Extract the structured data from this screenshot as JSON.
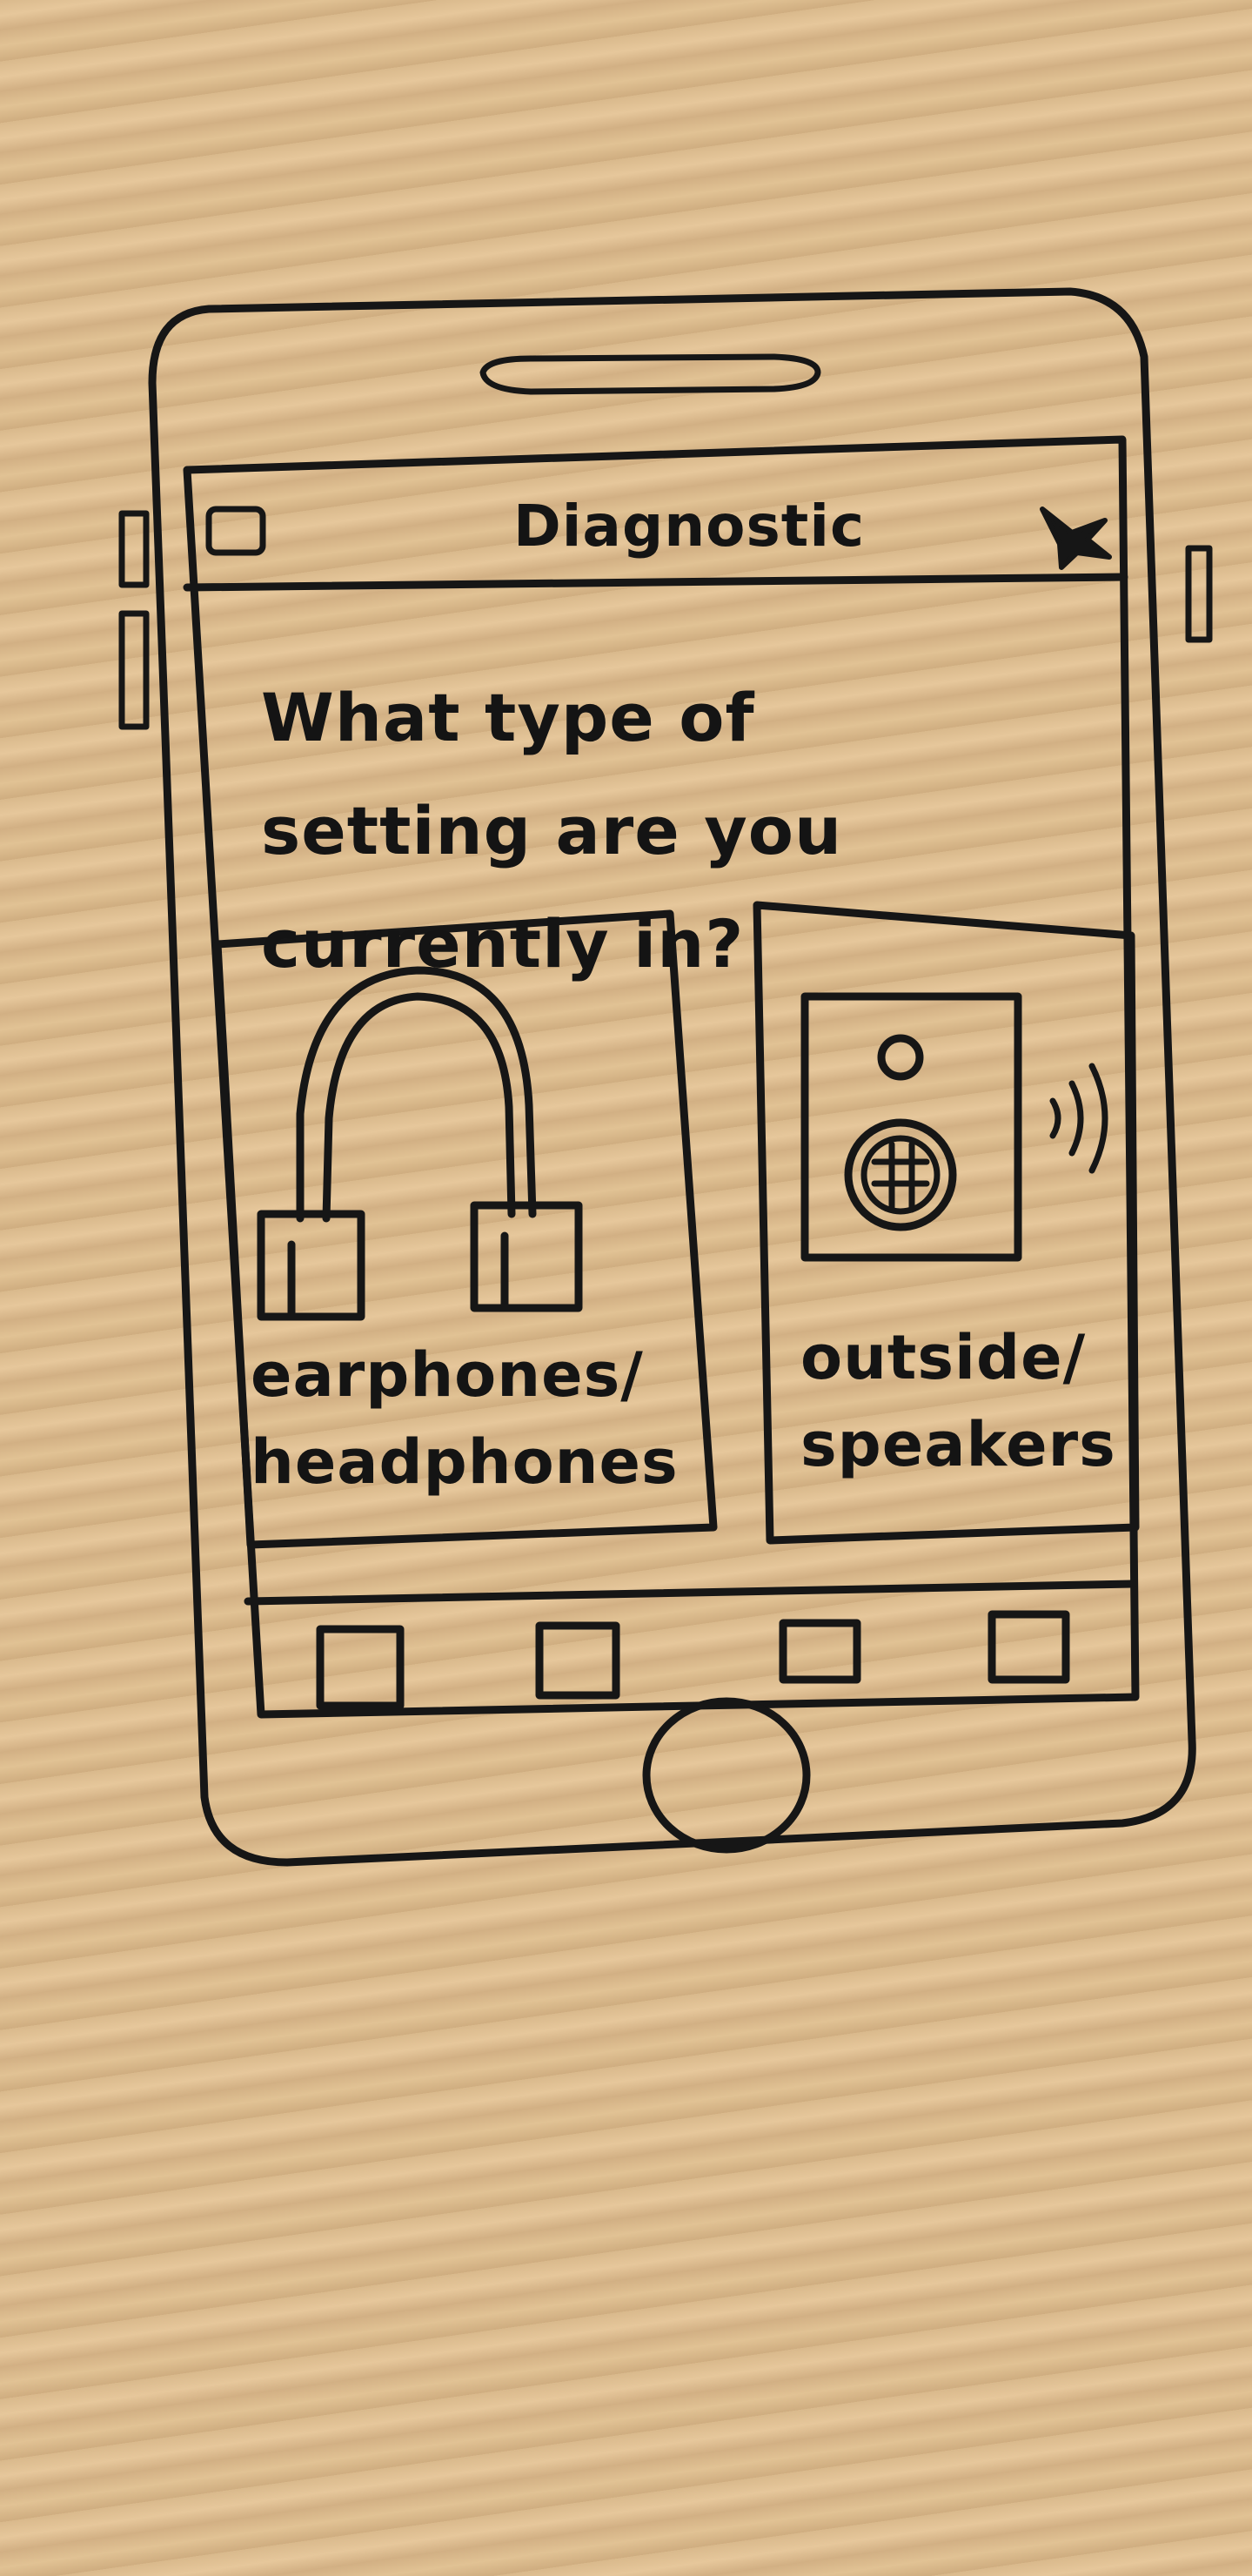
{
  "header": {
    "title": "Diagnostic",
    "left_icon": "square-icon",
    "right_icon": "bird-icon"
  },
  "question": "What type of setting are you currently in?",
  "options": [
    {
      "label": "earphones/ headphones",
      "icon": "headphones-icon"
    },
    {
      "label": "outside/ speakers",
      "icon": "speaker-icon"
    }
  ],
  "tabbar": {
    "icons": [
      "tab-square-icon",
      "tab-square-icon",
      "tab-square-icon",
      "tab-square-icon"
    ]
  },
  "home_button_icon": "circle-icon",
  "colors": {
    "ink": "#161616",
    "paper": "#f7f6f3"
  }
}
